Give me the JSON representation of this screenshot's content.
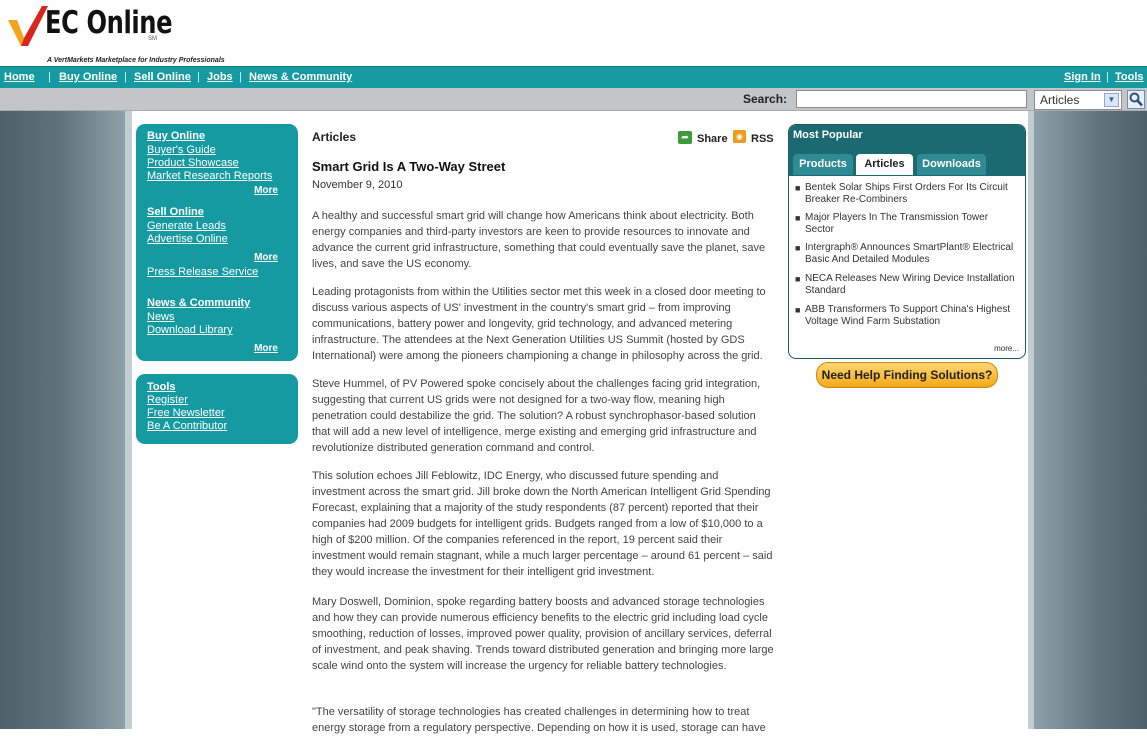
{
  "brand": {
    "logo_name": "EC Online",
    "logo_sm": "SM",
    "tagline": "A VertMarkets Marketplace for Industry Professionals"
  },
  "nav": {
    "links": [
      "Home",
      "Buy Online",
      "Sell Online",
      "Jobs",
      "News & Community"
    ],
    "sign_in": "Sign In",
    "tools": "Tools"
  },
  "search": {
    "label": "Search:",
    "value": "",
    "category": "Articles"
  },
  "left_boxes": {
    "buy_online_heading": "Buy Online",
    "buy_online_links": [
      "Buyer's Guide",
      "Product Showcase",
      "Market Research Reports"
    ],
    "sell_online_heading": "Sell Online",
    "sell_online_links": [
      "Generate Leads",
      "Advertise Online"
    ],
    "press_release": "Press Release Service",
    "news_heading": "News & Community",
    "news_links": [
      "News",
      "Download Library"
    ],
    "more_label": "More",
    "tools_heading": "Tools",
    "tools_links": [
      "Register",
      "Free Newsletter",
      "Be A Contributor"
    ]
  },
  "article": {
    "section_heading": "Articles",
    "share_label": "Share",
    "rss_label": "RSS",
    "title": "Smart Grid Is A Two-Way Street",
    "date": "November 9, 2010",
    "paragraphs": [
      "A healthy and successful smart grid will change how Americans think about electricity. Both energy companies and third-party investors are keen to provide resources to innovate and advance the current grid infrastructure, something that could eventually save the planet, save lives, and save the US economy.",
      "Leading protagonists from within the Utilities sector met this week in a closed door meeting to discuss various aspects of US' investment in the country's smart grid – from improving communications, battery power and longevity, grid technology, and advanced metering infrastructure. The attendees at the Next Generation Utilities US Summit (hosted by GDS International) were among the pioneers championing a change in philosophy across the grid.",
      "Steve Hummel, of PV Powered spoke concisely about the challenges facing grid integration, suggesting that current US grids were not designed for a two-way flow, meaning high penetration could destabilize the grid. The solution? A robust synchrophasor-based solution that will add a new level of intelligence, merge existing and emerging grid infrastructure and revolutionize distributed generation command and control.",
      "This solution echoes Jill Feblowitz, IDC Energy, who discussed future spending and investment across the smart grid. Jill broke down the North American Intelligent Grid Spending Forecast, explaining that a majority of the study respondents (87 percent) reported that their companies had 2009 budgets for intelligent grids. Budgets ranged from a low of $10,000 to a high of $200 million. Of the companies referenced in the report, 19 percent said their investment would remain stagnant, while a much larger percentage – around 61 percent – said they would increase the investment for their intelligent grid investment.",
      "Mary Doswell, Dominion, spoke regarding battery boosts and advanced storage technologies and how they can provide numerous efficiency benefits to the electric grid including load cycle smoothing, reduction of losses, improved power quality, provision of ancillary services, deferral of investment, and peak shaving. Trends toward distributed generation and bringing more large scale wind onto the system will increase the urgency for reliable battery technologies.",
      "\"The versatility of storage technologies has created challenges in determining how to treat energy storage from a regulatory perspective. Depending on how it is used, storage can have"
    ]
  },
  "most_popular": {
    "title": "Most Popular",
    "tabs": [
      "Products",
      "Articles",
      "Downloads"
    ],
    "active_tab": "Articles",
    "items": [
      "Bentek Solar Ships First Orders For Its Circuit Breaker Re-Combiners",
      "Major Players In The Transmission Tower Sector",
      "Intergraph® Announces SmartPlant® Electrical Basic And Detailed Modules",
      "NECA Releases New Wiring Device Installation Standard",
      "ABB Transformers To Support China's Highest Voltage Wind Farm Substation"
    ],
    "more_label": "more..."
  },
  "help_button": "Need Help Finding Solutions?",
  "colors": {
    "nav_teal": "#169aa1",
    "popular_header": "#1c6a71",
    "help_orange": "#f3a817",
    "logo_red": "#d9261c",
    "logo_orange": "#f5a31a"
  }
}
